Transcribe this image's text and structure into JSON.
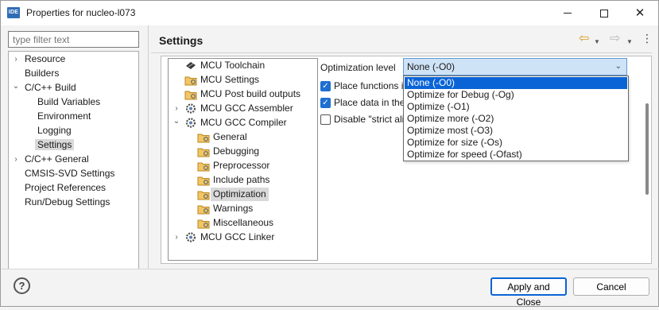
{
  "window": {
    "app_icon": "IDE",
    "title": "Properties for nucleo-l073",
    "minimize_icon": "minimize-icon",
    "maximize_icon": "maximize-icon",
    "close_icon": "close-icon"
  },
  "sidebar": {
    "filter_placeholder": "type filter text",
    "items": [
      {
        "label": "Resource",
        "expand": "›"
      },
      {
        "label": "Builders"
      },
      {
        "label": "C/C++ Build",
        "expand": "⌄"
      },
      {
        "label": "Build Variables"
      },
      {
        "label": "Environment"
      },
      {
        "label": "Logging"
      },
      {
        "label": "Settings",
        "selected": true
      },
      {
        "label": "C/C++ General",
        "expand": "›"
      },
      {
        "label": "CMSIS-SVD Settings"
      },
      {
        "label": "Project References"
      },
      {
        "label": "Run/Debug Settings"
      }
    ]
  },
  "header": {
    "title": "Settings",
    "icons": [
      "back-icon",
      "back-menu-icon",
      "forward-icon",
      "forward-menu-icon",
      "more-icon"
    ]
  },
  "tool_tree": {
    "items": [
      {
        "label": "MCU Toolchain",
        "icon": "toolchain-icon"
      },
      {
        "label": "MCU Settings",
        "icon": "settings-folder-icon"
      },
      {
        "label": "MCU Post build outputs",
        "icon": "settings-folder-icon"
      },
      {
        "label": "MCU GCC Assembler",
        "icon": "gear-icon",
        "expand": "›"
      },
      {
        "label": "MCU GCC Compiler",
        "icon": "gear-icon",
        "expand": "⌄"
      },
      {
        "label": "General",
        "icon": "settings-folder-icon"
      },
      {
        "label": "Debugging",
        "icon": "settings-folder-icon"
      },
      {
        "label": "Preprocessor",
        "icon": "settings-folder-icon"
      },
      {
        "label": "Include paths",
        "icon": "settings-folder-icon"
      },
      {
        "label": "Optimization",
        "icon": "settings-folder-icon",
        "selected": true
      },
      {
        "label": "Warnings",
        "icon": "settings-folder-icon"
      },
      {
        "label": "Miscellaneous",
        "icon": "settings-folder-icon"
      },
      {
        "label": "MCU GCC Linker",
        "icon": "gear-icon",
        "expand": "›"
      }
    ]
  },
  "optimization": {
    "label": "Optimization level",
    "selected": "None (-O0)",
    "checkboxes": [
      {
        "label": "Place functions i",
        "checked": true
      },
      {
        "label": "Place data in the",
        "checked": true
      },
      {
        "label": "Disable \"strict ali",
        "checked": false
      }
    ],
    "options": [
      "None (-O0)",
      "Optimize for Debug (-Og)",
      "Optimize (-O1)",
      "Optimize more (-O2)",
      "Optimize most (-O3)",
      "Optimize for size (-Os)",
      "Optimize for speed (-Ofast)"
    ]
  },
  "footer": {
    "help_icon": "help-icon",
    "apply_close": "Apply and Close",
    "cancel": "Cancel"
  },
  "colors": {
    "accent": "#0a64d6",
    "select_bg": "#cfe3f7",
    "folder": "#e8b64c"
  }
}
